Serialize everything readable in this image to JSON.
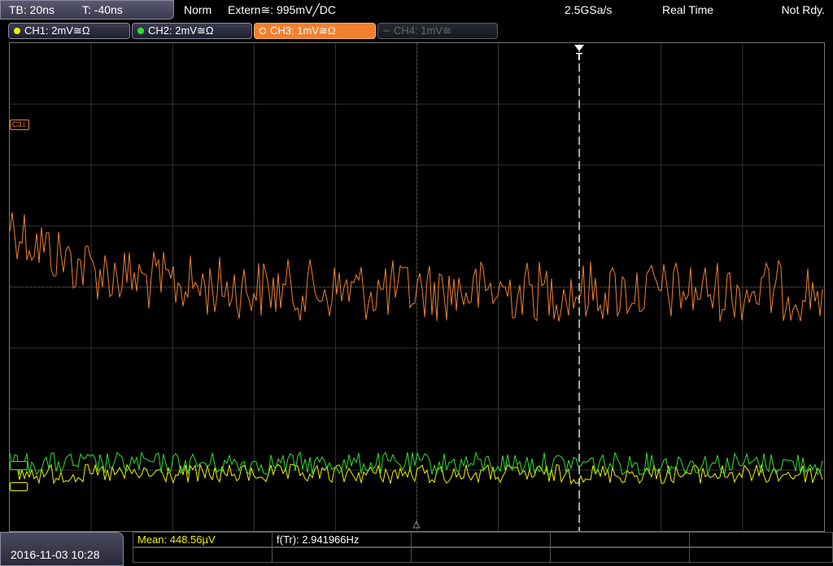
{
  "header": {
    "timebase": "TB: 20ns",
    "trigger_time": "T: -40ns",
    "trigger_mode": "Norm",
    "trigger_source": "Extern≅: 995mV╱DC",
    "sample_rate": "2.5GSa/s",
    "acq_mode": "Real Time",
    "status": "Not Rdy."
  },
  "channels": [
    {
      "label": "CH1: 2mV≅Ω",
      "color": "#f0f000",
      "state": "on"
    },
    {
      "label": "CH2: 2mV≅Ω",
      "color": "#30e030",
      "state": "on"
    },
    {
      "label": "CH3: 1mV≅Ω",
      "color": "#f08030",
      "state": "active"
    },
    {
      "label": "CH4: 1mV≅",
      "color": "#6a6a70",
      "state": "off"
    }
  ],
  "markers": {
    "ch3": "C3⟂",
    "trigger": "T"
  },
  "footer": {
    "datetime": "2016-11-03 10:28",
    "mean_label": "Mean: 448.56µV",
    "freq_label": "f(Tr): 2.941966Hz"
  },
  "colors": {
    "ch1": "#f0f000",
    "ch2": "#30e030",
    "ch3": "#f08030",
    "grid": "#3a3a3a",
    "axis": "#555555"
  }
}
